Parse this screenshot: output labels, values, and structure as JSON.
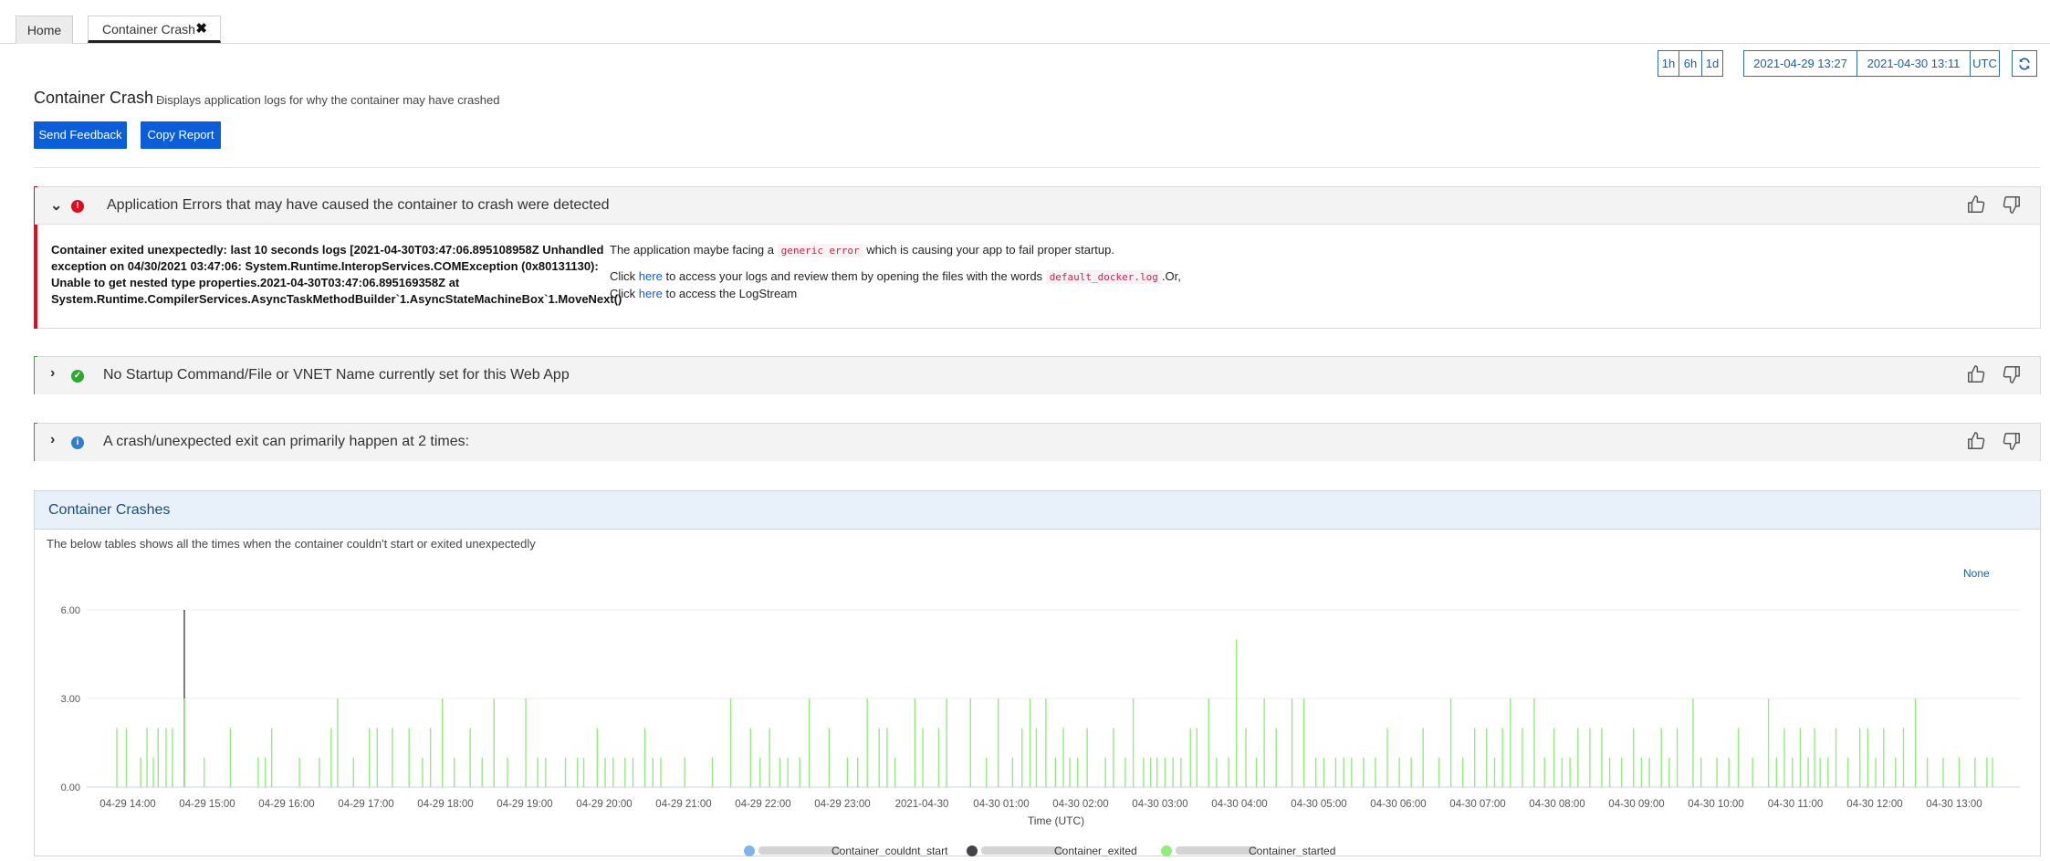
{
  "tabs": [
    {
      "label": "Home"
    },
    {
      "label": "Container Crash",
      "close": "✖"
    }
  ],
  "time_controls": {
    "presets": [
      "1h",
      "6h",
      "1d"
    ],
    "start": "2021-04-29 13:27",
    "end": "2021-04-30 13:11",
    "timezone": "UTC",
    "refresh_icon": "refresh-icon"
  },
  "header": {
    "title": "Container Crash",
    "separator": "-",
    "subtitle": "Displays application logs for why the container may have crashed",
    "send_feedback": "Send Feedback",
    "copy_report": "Copy Report"
  },
  "insights": [
    {
      "status": "critical",
      "color": "#e00b1c",
      "title": "Application Errors that may have caused the container to crash were detected",
      "error_log": "Container exited unexpectedly: last 10 seconds logs [2021-04-30T03:47:06.895108958Z Unhandled exception on 04/30/2021 03:47:06: System.Runtime.InteropServices.COMException (0x80131130): Unable to get nested type properties.2021-04-30T03:47:06.895169358Z at System.Runtime.CompilerServices.AsyncTaskMethodBuilder`1.AsyncStateMachineBox`1.MoveNext()",
      "desc_prefix": "The application maybe facing a",
      "desc_code": "generic error",
      "desc_suffix": "which is causing your app to fail proper startup.",
      "line2_prefix": "Click",
      "line2_link": "here",
      "line2_mid": "to access your logs and review them by opening the files with the words",
      "line2_code": "default_docker.log",
      "line2_suffix": ".Or,",
      "line3_prefix": "Click",
      "line3_link": "here",
      "line3_suffix": "to access the LogStream"
    },
    {
      "status": "success",
      "color": "#2fa82f",
      "title": "No Startup Command/File or VNET Name currently set for this Web App"
    },
    {
      "status": "info",
      "color": "#2f7ec7",
      "title": "A crash/unexpected exit can primarily happen at 2 times:"
    }
  ],
  "chart_card": {
    "title": "Container Crashes",
    "description": "The below tables shows all the times when the container couldn't start or exited unexpectedly",
    "none_label": "None"
  },
  "chart_data": {
    "type": "bar",
    "xlabel": "Time (UTC)",
    "ylabel": "",
    "ylim": [
      0,
      6
    ],
    "yticks": [
      "0.00",
      "3.00",
      "6.00"
    ],
    "grid": "horizontal",
    "legend_placement": "bottom",
    "x_tick_labels": [
      "04-29 14:00",
      "04-29 15:00",
      "04-29 16:00",
      "04-29 17:00",
      "04-29 18:00",
      "04-29 19:00",
      "04-29 20:00",
      "04-29 21:00",
      "04-29 22:00",
      "04-29 23:00",
      "2021-04-30",
      "04-30 01:00",
      "04-30 02:00",
      "04-30 03:00",
      "04-30 04:00",
      "04-30 05:00",
      "04-30 06:00",
      "04-30 07:00",
      "04-30 08:00",
      "04-30 09:00",
      "04-30 10:00",
      "04-30 11:00",
      "04-30 12:00",
      "04-30 13:00"
    ],
    "series": [
      {
        "name": "Container_couldnt_start",
        "color": "#7cb5ec",
        "values": []
      },
      {
        "name": "Container_exited",
        "color": "#434348",
        "values": [
          [
            0.85,
            6
          ]
        ]
      },
      {
        "name": "Container_started",
        "color": "#90ed7d",
        "values": [
          [
            0.0,
            2
          ],
          [
            0.12,
            2
          ],
          [
            0.3,
            1
          ],
          [
            0.38,
            2
          ],
          [
            0.46,
            1
          ],
          [
            0.52,
            2
          ],
          [
            0.62,
            2
          ],
          [
            0.7,
            2
          ],
          [
            0.85,
            3
          ],
          [
            1.1,
            1
          ],
          [
            1.43,
            2
          ],
          [
            1.78,
            1
          ],
          [
            1.87,
            1
          ],
          [
            1.95,
            2
          ],
          [
            2.3,
            1
          ],
          [
            2.55,
            1
          ],
          [
            2.7,
            2
          ],
          [
            2.78,
            3
          ],
          [
            2.98,
            1
          ],
          [
            3.18,
            2
          ],
          [
            3.28,
            2
          ],
          [
            3.47,
            2
          ],
          [
            3.68,
            2
          ],
          [
            3.85,
            1
          ],
          [
            3.95,
            2
          ],
          [
            4.1,
            3
          ],
          [
            4.25,
            1
          ],
          [
            4.45,
            2
          ],
          [
            4.6,
            1
          ],
          [
            4.75,
            3
          ],
          [
            4.92,
            1
          ],
          [
            5.15,
            3
          ],
          [
            5.3,
            1
          ],
          [
            5.4,
            1
          ],
          [
            5.65,
            1
          ],
          [
            5.8,
            1
          ],
          [
            5.88,
            1
          ],
          [
            6.05,
            2
          ],
          [
            6.15,
            1
          ],
          [
            6.25,
            1
          ],
          [
            6.4,
            1
          ],
          [
            6.5,
            1
          ],
          [
            6.65,
            2
          ],
          [
            6.75,
            1
          ],
          [
            6.85,
            1
          ],
          [
            7.15,
            1
          ],
          [
            7.5,
            1
          ],
          [
            7.73,
            3
          ],
          [
            7.98,
            2
          ],
          [
            8.1,
            1
          ],
          [
            8.22,
            2
          ],
          [
            8.35,
            1
          ],
          [
            8.45,
            1
          ],
          [
            8.6,
            1
          ],
          [
            8.72,
            3
          ],
          [
            8.97,
            2
          ],
          [
            9.2,
            1
          ],
          [
            9.33,
            1
          ],
          [
            9.45,
            3
          ],
          [
            9.6,
            2
          ],
          [
            9.7,
            2
          ],
          [
            9.8,
            1
          ],
          [
            10.05,
            3
          ],
          [
            10.15,
            2
          ],
          [
            10.35,
            2
          ],
          [
            10.45,
            3
          ],
          [
            10.75,
            3
          ],
          [
            10.95,
            1
          ],
          [
            11.1,
            3
          ],
          [
            11.28,
            1
          ],
          [
            11.4,
            2
          ],
          [
            11.5,
            3
          ],
          [
            11.58,
            2
          ],
          [
            11.7,
            3
          ],
          [
            11.82,
            1
          ],
          [
            11.92,
            2
          ],
          [
            12.0,
            1
          ],
          [
            12.1,
            1
          ],
          [
            12.22,
            2
          ],
          [
            12.45,
            1
          ],
          [
            12.55,
            2
          ],
          [
            12.7,
            1
          ],
          [
            12.8,
            3
          ],
          [
            12.93,
            1
          ],
          [
            13.02,
            1
          ],
          [
            13.1,
            1
          ],
          [
            13.2,
            1
          ],
          [
            13.3,
            1
          ],
          [
            13.4,
            1
          ],
          [
            13.52,
            2
          ],
          [
            13.6,
            2
          ],
          [
            13.75,
            3
          ],
          [
            13.85,
            1
          ],
          [
            14.0,
            1
          ],
          [
            14.1,
            5
          ],
          [
            14.22,
            2
          ],
          [
            14.35,
            1
          ],
          [
            14.45,
            3
          ],
          [
            14.6,
            2
          ],
          [
            14.8,
            3
          ],
          [
            14.95,
            3
          ],
          [
            15.1,
            1
          ],
          [
            15.2,
            1
          ],
          [
            15.35,
            1
          ],
          [
            15.45,
            1
          ],
          [
            15.55,
            1
          ],
          [
            15.7,
            1
          ],
          [
            15.85,
            1
          ],
          [
            16.0,
            2
          ],
          [
            16.15,
            1
          ],
          [
            16.3,
            1
          ],
          [
            16.45,
            2
          ],
          [
            16.65,
            1
          ],
          [
            16.8,
            3
          ],
          [
            16.95,
            1
          ],
          [
            17.1,
            2
          ],
          [
            17.25,
            2
          ],
          [
            17.35,
            1
          ],
          [
            17.45,
            2
          ],
          [
            17.55,
            3
          ],
          [
            17.7,
            2
          ],
          [
            17.85,
            3
          ],
          [
            17.98,
            1
          ],
          [
            18.1,
            2
          ],
          [
            18.2,
            1
          ],
          [
            18.3,
            1
          ],
          [
            18.4,
            2
          ],
          [
            18.55,
            2
          ],
          [
            18.7,
            2
          ],
          [
            18.8,
            1
          ],
          [
            18.95,
            1
          ],
          [
            19.1,
            2
          ],
          [
            19.2,
            1
          ],
          [
            19.3,
            1
          ],
          [
            19.45,
            2
          ],
          [
            19.55,
            1
          ],
          [
            19.65,
            2
          ],
          [
            19.85,
            3
          ],
          [
            19.95,
            1
          ],
          [
            20.15,
            1
          ],
          [
            20.3,
            1
          ],
          [
            20.42,
            2
          ],
          [
            20.6,
            1
          ],
          [
            20.8,
            3
          ],
          [
            20.9,
            1
          ],
          [
            21.0,
            2
          ],
          [
            21.1,
            1
          ],
          [
            21.2,
            2
          ],
          [
            21.3,
            1
          ],
          [
            21.38,
            2
          ],
          [
            21.45,
            1
          ],
          [
            21.55,
            1
          ],
          [
            21.65,
            2
          ],
          [
            21.8,
            1
          ],
          [
            21.95,
            2
          ],
          [
            22.05,
            2
          ],
          [
            22.15,
            1
          ],
          [
            22.25,
            2
          ],
          [
            22.4,
            1
          ],
          [
            22.5,
            2
          ],
          [
            22.65,
            3
          ],
          [
            22.8,
            1
          ],
          [
            23.0,
            1
          ],
          [
            23.2,
            1
          ],
          [
            23.4,
            1
          ],
          [
            23.55,
            1
          ],
          [
            23.62,
            1
          ]
        ]
      }
    ]
  }
}
